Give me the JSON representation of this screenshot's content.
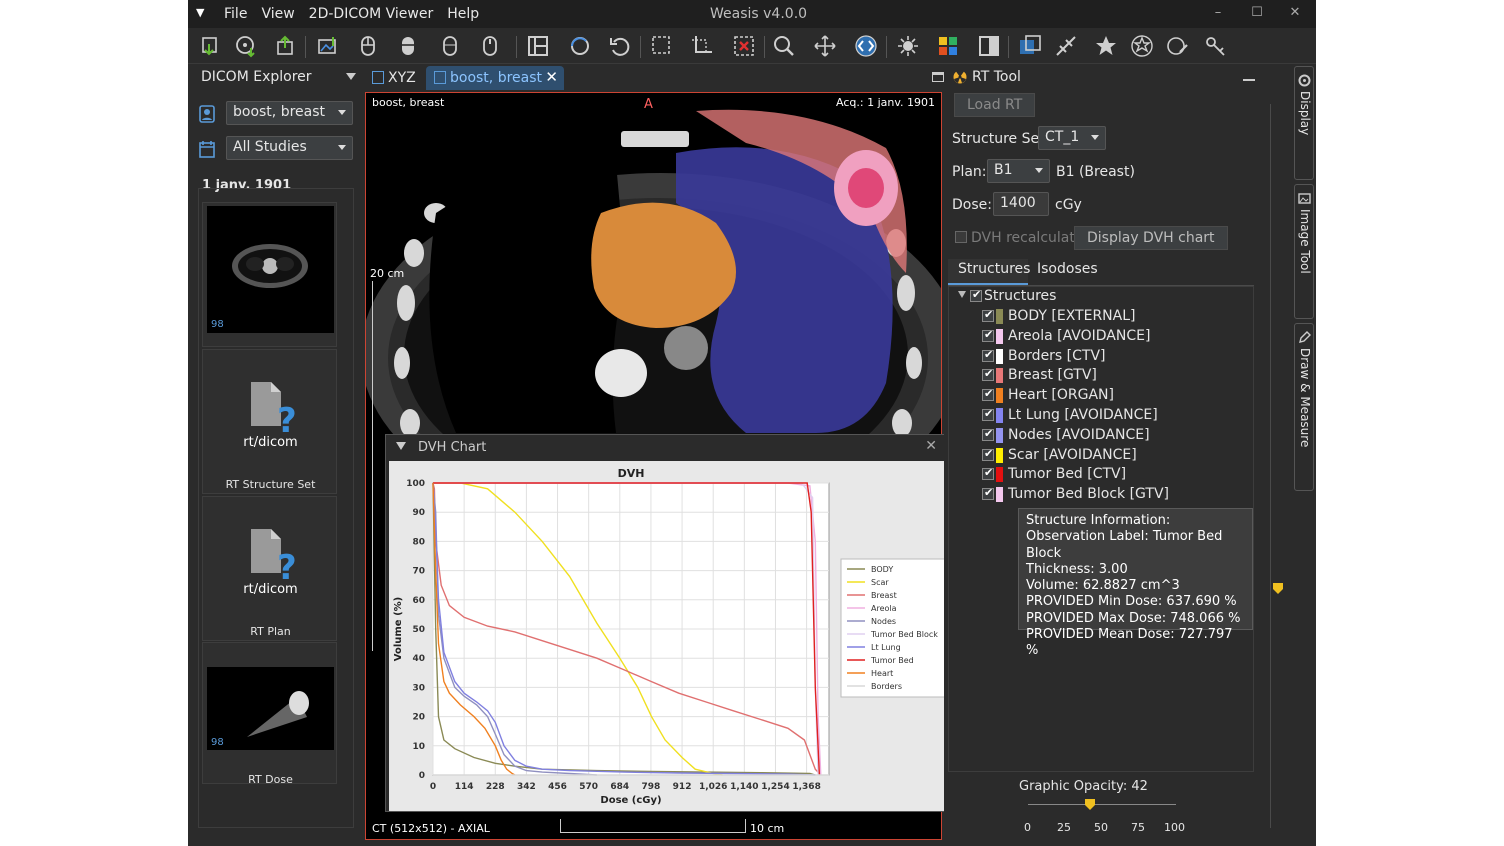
{
  "app": {
    "title": "Weasis v4.0.0"
  },
  "menu": [
    "File",
    "View",
    "2D-DICOM Viewer",
    "Help"
  ],
  "explorer": {
    "title": "DICOM Explorer",
    "patient": "boost, breast",
    "studies": "All Studies",
    "date": "1 janv. 1901",
    "thumbs": [
      {
        "caption": "",
        "count": "98"
      },
      {
        "caption": "RT Structure Set",
        "icon_label": "rt/dicom"
      },
      {
        "caption": "RT Plan",
        "icon_label": "rt/dicom"
      },
      {
        "caption": "RT Dose",
        "count": "98"
      }
    ]
  },
  "viewer": {
    "tabs": [
      "XYZ",
      "boost, breast"
    ],
    "patient_name": "boost, breast",
    "acq": "Acq.: 1 janv. 1901",
    "orientation": "A",
    "scale_label": "20 cm",
    "series": "CT (512x512) - AXIAL",
    "ruler_label": "10 cm"
  },
  "dvh_window": {
    "title": "DVH Chart"
  },
  "chart_data": {
    "type": "line",
    "title": "DVH",
    "xlabel": "Dose (cGy)",
    "ylabel": "Volume (%)",
    "xlim": [
      0,
      1450
    ],
    "ylim": [
      0,
      100
    ],
    "xticks": [
      "0",
      "114",
      "228",
      "342",
      "456",
      "570",
      "684",
      "798",
      "912",
      "1,026",
      "1,140",
      "1,254",
      "1,368"
    ],
    "yticks": [
      "0",
      "10",
      "20",
      "30",
      "40",
      "50",
      "60",
      "70",
      "80",
      "90",
      "100"
    ],
    "legend_position": "right",
    "series": [
      {
        "name": "BODY",
        "color": "#8a8a55",
        "x": [
          0,
          10,
          20,
          40,
          80,
          150,
          228,
          300,
          400,
          600,
          800,
          1000,
          1200,
          1380,
          1400
        ],
        "y": [
          100,
          50,
          20,
          12,
          9,
          6,
          4,
          3,
          2,
          1.5,
          1.2,
          1,
          0.8,
          0.5,
          0
        ]
      },
      {
        "name": "Scar",
        "color": "#f0e020",
        "x": [
          0,
          100,
          200,
          300,
          400,
          500,
          600,
          684,
          750,
          800,
          850,
          912,
          960,
          1026,
          1060
        ],
        "y": [
          100,
          100,
          98,
          90,
          80,
          68,
          52,
          40,
          30,
          20,
          12,
          6,
          2,
          0.5,
          0
        ]
      },
      {
        "name": "Breast",
        "color": "#e07070",
        "x": [
          0,
          5,
          10,
          30,
          60,
          114,
          200,
          300,
          400,
          500,
          600,
          700,
          800,
          900,
          1000,
          1100,
          1200,
          1300,
          1360,
          1400,
          1420
        ],
        "y": [
          100,
          98,
          80,
          65,
          58,
          54,
          51,
          49,
          46,
          43,
          40,
          36,
          32,
          28,
          25,
          22,
          19,
          16,
          12,
          2,
          0
        ]
      },
      {
        "name": "Areola",
        "color": "#f0b0e0",
        "x": [
          0,
          1300,
          1380,
          1400,
          1410,
          1420
        ],
        "y": [
          100,
          100,
          99,
          80,
          20,
          0
        ]
      },
      {
        "name": "Nodes",
        "color": "#9090c0",
        "x": [
          0,
          10,
          20,
          40,
          80,
          114,
          160,
          200,
          228,
          260,
          300,
          342,
          400,
          500,
          600
        ],
        "y": [
          100,
          90,
          55,
          40,
          30,
          27,
          24,
          20,
          14,
          7,
          3,
          1.5,
          1,
          0.5,
          0
        ]
      },
      {
        "name": "Tumor Bed Block",
        "color": "#e0d0f0",
        "x": [
          0,
          1350,
          1390,
          1400,
          1410
        ],
        "y": [
          100,
          100,
          95,
          30,
          0
        ]
      },
      {
        "name": "Lt Lung",
        "color": "#8080e0",
        "x": [
          0,
          10,
          20,
          40,
          80,
          114,
          160,
          200,
          228,
          260,
          300,
          342,
          400,
          500,
          700,
          900,
          1100,
          1300,
          1400
        ],
        "y": [
          100,
          85,
          60,
          42,
          32,
          28,
          25,
          22,
          18,
          10,
          5,
          3,
          2,
          1.5,
          1,
          0.7,
          0.5,
          0.3,
          0
        ]
      },
      {
        "name": "Tumor Bed",
        "color": "#e02020",
        "x": [
          0,
          1370,
          1385,
          1400,
          1415
        ],
        "y": [
          100,
          100,
          90,
          30,
          0
        ]
      },
      {
        "name": "Heart",
        "color": "#f08020",
        "x": [
          0,
          10,
          20,
          40,
          60,
          100,
          150,
          190,
          228,
          250,
          270,
          290,
          300
        ],
        "y": [
          100,
          70,
          45,
          32,
          28,
          24,
          20,
          16,
          10,
          5,
          2,
          0.5,
          0
        ]
      },
      {
        "name": "Borders",
        "color": "#d8d8d8",
        "x": [
          0,
          1450
        ],
        "y": [
          0,
          0
        ]
      }
    ]
  },
  "rt_tool": {
    "title": "RT Tool",
    "load_btn": "Load RT",
    "structure_set_label": "Structure Set:",
    "structure_set": "CT_1",
    "plan_label": "Plan:",
    "plan": "B1",
    "plan_desc": "B1 (Breast)",
    "dose_label": "Dose:",
    "dose": "1400",
    "dose_unit": "cGy",
    "dvh_recalc": "DVH recalculate",
    "display_dvh": "Display DVH chart",
    "tabs": [
      "Structures",
      "Isodoses"
    ],
    "root": "Structures",
    "structures": [
      {
        "name": "BODY [EXTERNAL]",
        "color": "#8a8a55"
      },
      {
        "name": "Areola [AVOIDANCE]",
        "color": "#f4c8ee"
      },
      {
        "name": "Borders [CTV]",
        "color": "#ffffff"
      },
      {
        "name": "Breast [GTV]",
        "color": "#e87878"
      },
      {
        "name": "Heart [ORGAN]",
        "color": "#f08020"
      },
      {
        "name": "Lt Lung [AVOIDANCE]",
        "color": "#8484f0"
      },
      {
        "name": "Nodes [AVOIDANCE]",
        "color": "#9494f0"
      },
      {
        "name": "Scar [AVOIDANCE]",
        "color": "#ffee00"
      },
      {
        "name": "Tumor Bed [CTV]",
        "color": "#e41010"
      },
      {
        "name": "Tumor Bed Block [GTV]",
        "color": "#f4c8ee"
      }
    ],
    "tooltip": [
      "Structure Information:",
      "Observation Label: Tumor Bed Block",
      "Thickness: 3.00",
      "Volume: 62.8827 cm^3",
      "PROVIDED Min Dose: 637.690 %",
      "PROVIDED Max Dose: 748.066 %",
      "PROVIDED Mean Dose: 727.797 %"
    ],
    "opacity_label": "Graphic Opacity: 42",
    "opacity_value": 42,
    "slider_ticks": [
      "0",
      "25",
      "50",
      "75",
      "100"
    ]
  },
  "side_tabs": [
    "Display",
    "Image Tool",
    "Draw & Measure"
  ]
}
